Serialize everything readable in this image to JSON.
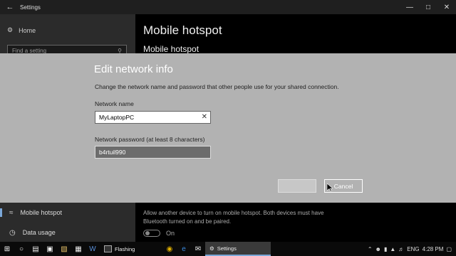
{
  "window": {
    "title": "Settings",
    "back_icon": "back-arrow-icon"
  },
  "sidebar": {
    "home_label": "Home",
    "search_placeholder": "Find a setting",
    "items": [
      {
        "label": "Mobile hotspot",
        "active": true
      },
      {
        "label": "Data usage",
        "active": false
      }
    ]
  },
  "main": {
    "title": "Mobile hotspot",
    "subtitle": "Mobile hotspot",
    "bluetooth_desc": "Allow another device to turn on mobile hotspot. Both devices must have Bluetooth turned on and be paired.",
    "toggle_label": "On"
  },
  "dialog": {
    "title": "Edit network info",
    "description": "Change the network name and password that other people use for your shared connection.",
    "network_name_label": "Network name",
    "network_name_value": "MyLaptopPC",
    "password_label": "Network password (at least 8 characters)",
    "password_value": "b4rtuil990",
    "save_label": "",
    "cancel_label": "Cancel"
  },
  "taskbar": {
    "apps": [
      {
        "label": "Flashing",
        "active": false
      },
      {
        "label": "Settings",
        "active": true
      }
    ],
    "language": "ENG",
    "time": "4:28 PM"
  },
  "colors": {
    "dialog_bg": "#b2b2b2",
    "accent": "#7aa7d8"
  }
}
